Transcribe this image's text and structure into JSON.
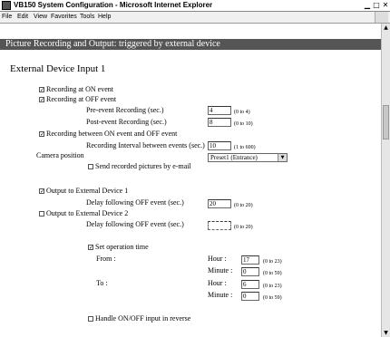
{
  "window": {
    "title": "VB150 System Configuration - Microsoft Internet Explorer",
    "minimize_icon": "minimize-icon",
    "maximize_icon": "maximize-icon",
    "close_icon": "close-icon"
  },
  "menu": {
    "file": "File",
    "edit": "Edit",
    "view": "View",
    "favorites": "Favorites",
    "tools": "Tools",
    "help": "Help"
  },
  "page": {
    "header": "Picture Recording and Output: triggered by external device",
    "section_title": "External Device Input 1",
    "recording_on": {
      "label": "Recording at ON event",
      "checked": true
    },
    "recording_off": {
      "label": "Recording at OFF event",
      "checked": true
    },
    "pre_event": {
      "label": "Pre-event Recording (sec.)",
      "value": "4",
      "range": "(0 to 4)"
    },
    "post_event": {
      "label": "Post-event Recording (sec.)",
      "value": "8",
      "range": "(0 to 10)"
    },
    "recording_between": {
      "label": "Recording between ON event and OFF event",
      "checked": true
    },
    "interval": {
      "label": "Recording Interval between events (sec.)",
      "value": "10",
      "range": "(1 to 600)"
    },
    "camera_position": {
      "label": "Camera position",
      "selected": "Preset1 (Entrance)"
    },
    "send_email": {
      "label": "Send recorded pictures by e-mail",
      "checked": false
    },
    "output1": {
      "label": "Output to External Device 1",
      "checked": true
    },
    "delay1": {
      "label": "Delay following OFF event (sec.)",
      "value": "20",
      "range": "(0 to 20)"
    },
    "output2": {
      "label": "Output to External Device 2",
      "checked": false
    },
    "delay2": {
      "label": "Delay following OFF event (sec.)",
      "value": "",
      "range": "(0 to 20)"
    },
    "set_time": {
      "label": "Set operation time",
      "checked": true
    },
    "from_label": "From :",
    "to_label": "To :",
    "hour_label": "Hour :",
    "minute_label": "Minute :",
    "from_hour": {
      "value": "17",
      "range": "(0 to 23)"
    },
    "from_minute": {
      "value": "0",
      "range": "(0 to 59)"
    },
    "to_hour": {
      "value": "6",
      "range": "(0 to 23)"
    },
    "to_minute": {
      "value": "0",
      "range": "(0 to 59)"
    },
    "reverse": {
      "label": "Handle ON/OFF input in reverse",
      "checked": false
    },
    "check_glyph": "✓"
  }
}
